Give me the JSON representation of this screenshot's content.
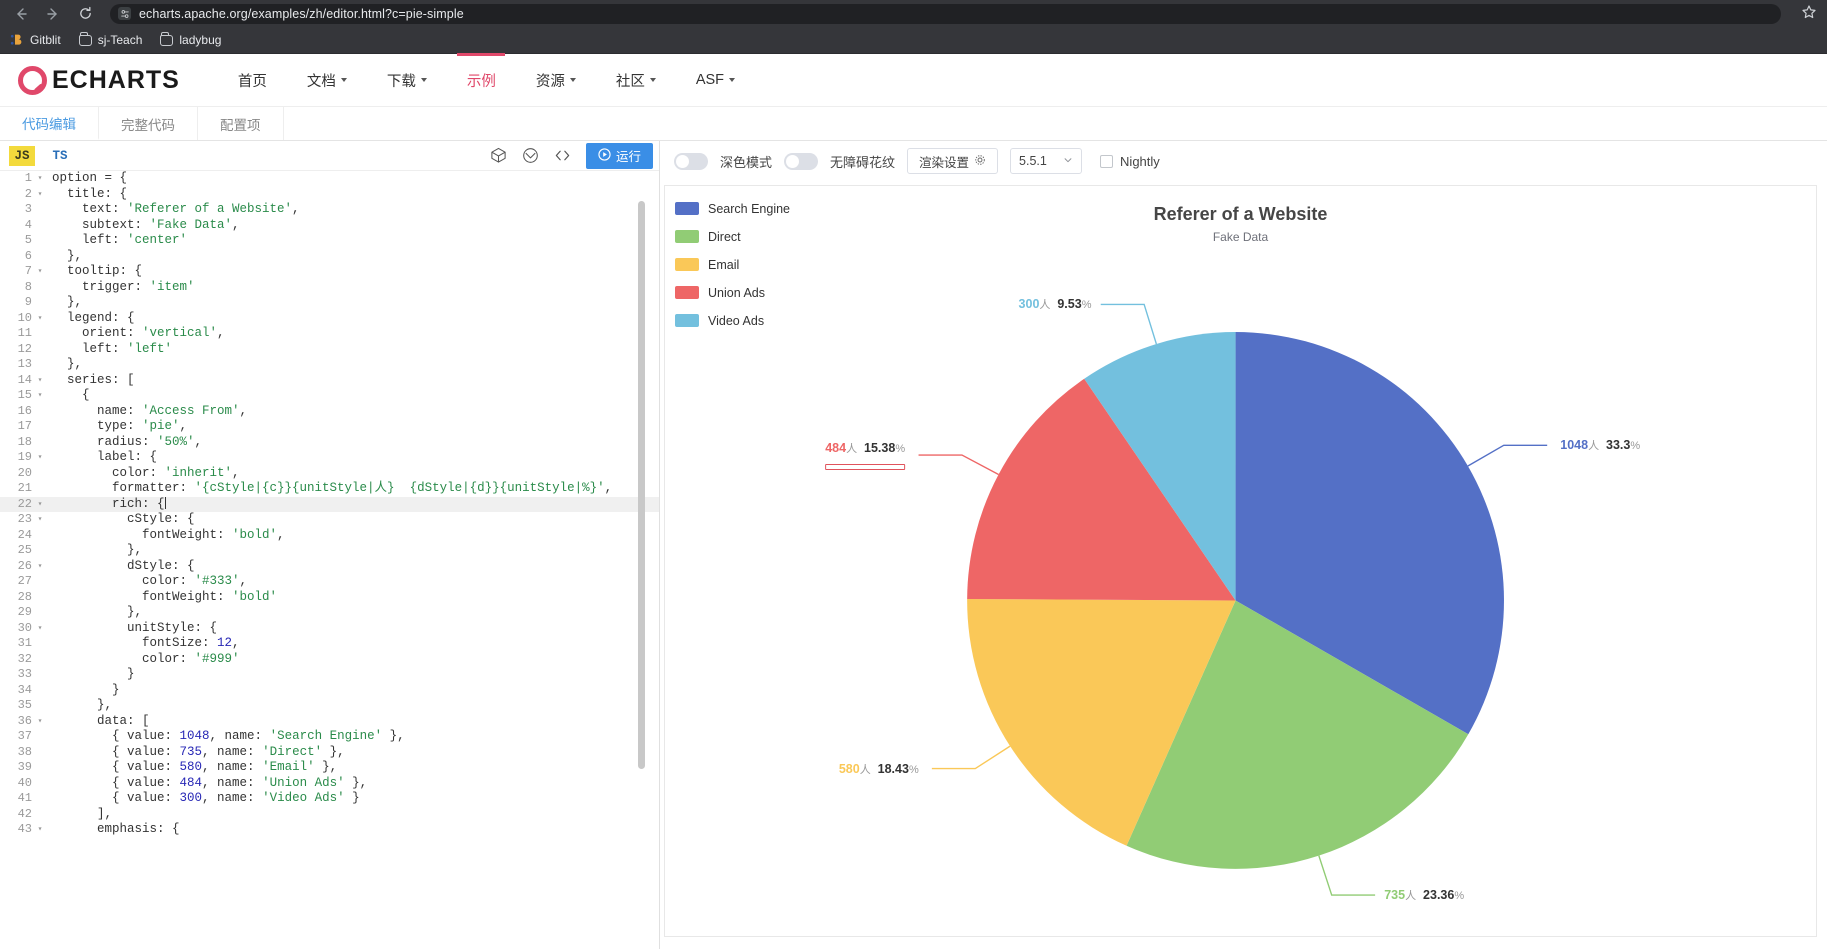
{
  "browser": {
    "url": "echarts.apache.org/examples/zh/editor.html?c=pie-simple",
    "back_icon": "back-arrow-icon",
    "forward_icon": "forward-arrow-icon",
    "reload_icon": "reload-icon",
    "star_icon": "star-icon",
    "bookmarks": [
      {
        "label": "Gitblit",
        "icon": "gitblit-icon"
      },
      {
        "label": "sj-Teach",
        "icon": "folder-icon"
      },
      {
        "label": "ladybug",
        "icon": "folder-icon"
      }
    ]
  },
  "site": {
    "logo_text": "ECHARTS",
    "nav": [
      {
        "label": "首页",
        "has_caret": false,
        "active": false
      },
      {
        "label": "文档",
        "has_caret": true,
        "active": false
      },
      {
        "label": "下载",
        "has_caret": true,
        "active": false
      },
      {
        "label": "示例",
        "has_caret": false,
        "active": true
      },
      {
        "label": "资源",
        "has_caret": true,
        "active": false
      },
      {
        "label": "社区",
        "has_caret": true,
        "active": false
      },
      {
        "label": "ASF",
        "has_caret": true,
        "active": false
      }
    ],
    "accent_color": "#e0486a"
  },
  "editor_tabs": [
    {
      "label": "代码编辑",
      "active": true
    },
    {
      "label": "完整代码",
      "active": false
    },
    {
      "label": "配置项",
      "active": false
    }
  ],
  "code_toolbar": {
    "js_label": "JS",
    "ts_label": "TS",
    "icons": [
      "palette-icon",
      "cube-icon",
      "code-brackets-icon"
    ],
    "run_label": "运行",
    "run_icon": "play-circle-icon"
  },
  "chart_toolbar": {
    "dark_mode_label": "深色模式",
    "dark_mode_on": false,
    "accessibility_label": "无障碍花纹",
    "accessibility_on": false,
    "render_settings_label": "渲染设置",
    "render_settings_icon": "gear-icon",
    "version": "5.5.1",
    "version_caret_icon": "chevron-down-icon",
    "nightly_label": "Nightly",
    "nightly_checked": false
  },
  "code": {
    "cursor_line": 22,
    "lines": [
      {
        "n": 1,
        "fold": true,
        "text": "option = {"
      },
      {
        "n": 2,
        "fold": true,
        "text": "  title: {"
      },
      {
        "n": 3,
        "fold": false,
        "text": "    text: 'Referer of a Website',"
      },
      {
        "n": 4,
        "fold": false,
        "text": "    subtext: 'Fake Data',"
      },
      {
        "n": 5,
        "fold": false,
        "text": "    left: 'center'"
      },
      {
        "n": 6,
        "fold": false,
        "text": "  },"
      },
      {
        "n": 7,
        "fold": true,
        "text": "  tooltip: {"
      },
      {
        "n": 8,
        "fold": false,
        "text": "    trigger: 'item'"
      },
      {
        "n": 9,
        "fold": false,
        "text": "  },"
      },
      {
        "n": 10,
        "fold": true,
        "text": "  legend: {"
      },
      {
        "n": 11,
        "fold": false,
        "text": "    orient: 'vertical',"
      },
      {
        "n": 12,
        "fold": false,
        "text": "    left: 'left'"
      },
      {
        "n": 13,
        "fold": false,
        "text": "  },"
      },
      {
        "n": 14,
        "fold": true,
        "text": "  series: ["
      },
      {
        "n": 15,
        "fold": true,
        "text": "    {"
      },
      {
        "n": 16,
        "fold": false,
        "text": "      name: 'Access From',"
      },
      {
        "n": 17,
        "fold": false,
        "text": "      type: 'pie',"
      },
      {
        "n": 18,
        "fold": false,
        "text": "      radius: '50%',"
      },
      {
        "n": 19,
        "fold": true,
        "text": "      label: {"
      },
      {
        "n": 20,
        "fold": false,
        "text": "        color: 'inherit',"
      },
      {
        "n": 21,
        "fold": false,
        "text": "        formatter: '{cStyle|{c}}{unitStyle|人}  {dStyle|{d}}{unitStyle|%}',"
      },
      {
        "n": 22,
        "fold": true,
        "text": "        rich: {"
      },
      {
        "n": 23,
        "fold": true,
        "text": "          cStyle: {"
      },
      {
        "n": 24,
        "fold": false,
        "text": "            fontWeight: 'bold',"
      },
      {
        "n": 25,
        "fold": false,
        "text": "          },"
      },
      {
        "n": 26,
        "fold": true,
        "text": "          dStyle: {"
      },
      {
        "n": 27,
        "fold": false,
        "text": "            color: '#333',"
      },
      {
        "n": 28,
        "fold": false,
        "text": "            fontWeight: 'bold'"
      },
      {
        "n": 29,
        "fold": false,
        "text": "          },"
      },
      {
        "n": 30,
        "fold": true,
        "text": "          unitStyle: {"
      },
      {
        "n": 31,
        "fold": false,
        "text": "            fontSize: 12,"
      },
      {
        "n": 32,
        "fold": false,
        "text": "            color: '#999'"
      },
      {
        "n": 33,
        "fold": false,
        "text": "          }"
      },
      {
        "n": 34,
        "fold": false,
        "text": "        }"
      },
      {
        "n": 35,
        "fold": false,
        "text": "      },"
      },
      {
        "n": 36,
        "fold": true,
        "text": "      data: ["
      },
      {
        "n": 37,
        "fold": false,
        "text": "        { value: 1048, name: 'Search Engine' },"
      },
      {
        "n": 38,
        "fold": false,
        "text": "        { value: 735, name: 'Direct' },"
      },
      {
        "n": 39,
        "fold": false,
        "text": "        { value: 580, name: 'Email' },"
      },
      {
        "n": 40,
        "fold": false,
        "text": "        { value: 484, name: 'Union Ads' },"
      },
      {
        "n": 41,
        "fold": false,
        "text": "        { value: 300, name: 'Video Ads' }"
      },
      {
        "n": 42,
        "fold": false,
        "text": "      ],"
      },
      {
        "n": 43,
        "fold": true,
        "text": "      emphasis: {"
      }
    ]
  },
  "chart_data": {
    "type": "pie",
    "title": "Referer of a Website",
    "subtitle": "Fake Data",
    "series_name": "Access From",
    "unit_suffix": "人",
    "legend_position": "left-vertical",
    "categories": [
      "Search Engine",
      "Direct",
      "Email",
      "Union Ads",
      "Video Ads"
    ],
    "values": [
      1048,
      735,
      580,
      484,
      300
    ],
    "percents": [
      "33.3",
      "23.36",
      "18.43",
      "15.38",
      "9.53"
    ],
    "colors": [
      "#5470c6",
      "#91cc75",
      "#fac858",
      "#ee6666",
      "#73c0de"
    ],
    "labels": [
      {
        "name": "Search Engine",
        "value": "1048",
        "unit": "人",
        "percent": "33.3",
        "pct_unit": "%",
        "color": "#5470c6"
      },
      {
        "name": "Direct",
        "value": "735",
        "unit": "人",
        "percent": "23.36",
        "pct_unit": "%",
        "color": "#91cc75"
      },
      {
        "name": "Email",
        "value": "580",
        "unit": "人",
        "percent": "18.43",
        "pct_unit": "%",
        "color": "#fac858"
      },
      {
        "name": "Union Ads",
        "value": "484",
        "unit": "人",
        "percent": "15.38",
        "pct_unit": "%",
        "color": "#ee6666"
      },
      {
        "name": "Video Ads",
        "value": "300",
        "unit": "人",
        "percent": "9.53",
        "pct_unit": "%",
        "color": "#73c0de"
      }
    ]
  }
}
